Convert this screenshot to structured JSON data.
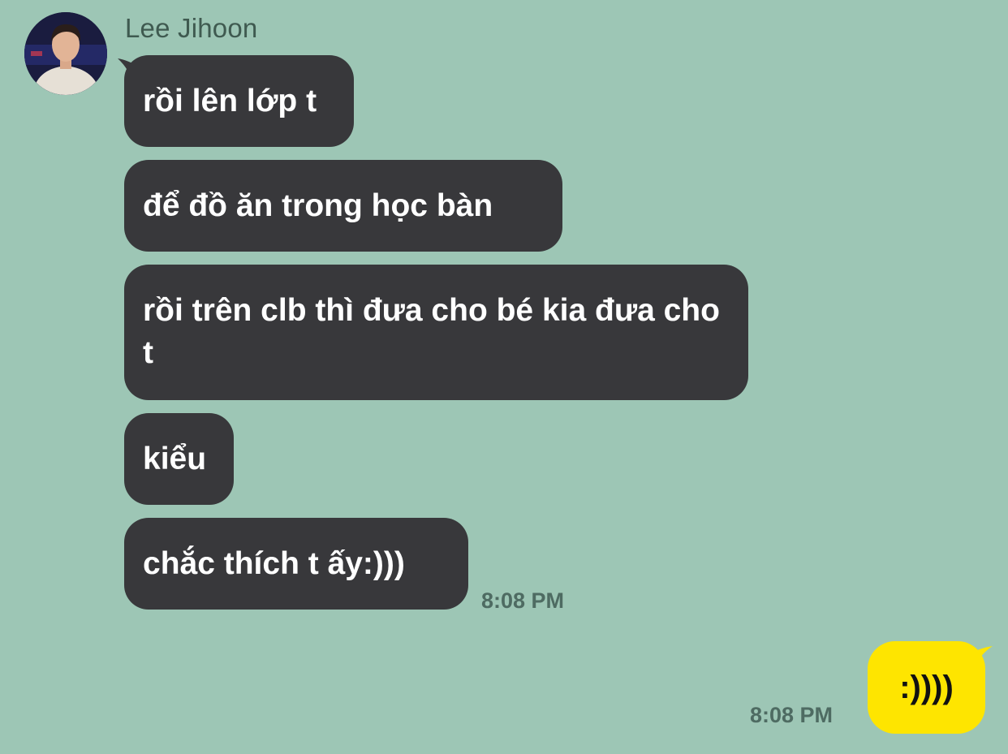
{
  "chat": {
    "sender": {
      "name": "Lee Jihoon",
      "avatar_icon": "profile-photo"
    },
    "incoming_messages": [
      {
        "text": "rồi lên lớp t"
      },
      {
        "text": "để đồ ăn trong học bàn"
      },
      {
        "text": "rồi trên clb thì đưa cho bé kia đưa cho t"
      },
      {
        "text": "kiểu"
      },
      {
        "text": "chắc thích t ấy:)))"
      }
    ],
    "incoming_time": "8:08 PM",
    "outgoing_messages": [
      {
        "text": ":))))"
      }
    ],
    "outgoing_time": "8:08 PM"
  },
  "colors": {
    "background": "#9dc6b5",
    "incoming_bubble": "#38383b",
    "outgoing_bubble": "#fee500",
    "timestamp": "#4e6b62"
  }
}
